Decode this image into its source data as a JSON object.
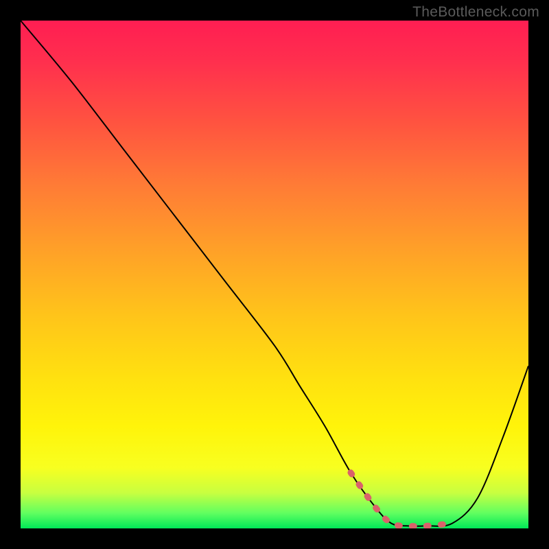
{
  "watermark": "TheBottleneck.com",
  "chart_data": {
    "type": "line",
    "title": "",
    "xlabel": "",
    "ylabel": "",
    "xlim": [
      0,
      100
    ],
    "ylim": [
      0,
      100
    ],
    "series": [
      {
        "name": "bottleneck-curve",
        "x": [
          0,
          10,
          20,
          30,
          40,
          50,
          55,
          60,
          65,
          70,
          73,
          76,
          80,
          85,
          90,
          95,
          100
        ],
        "values": [
          100,
          88,
          75,
          62,
          49,
          36,
          28,
          20,
          11,
          4,
          1,
          0.5,
          0.5,
          1,
          6,
          18,
          32
        ]
      }
    ],
    "optimal_zone": {
      "x_start": 65,
      "x_end": 87
    },
    "gradient_stops": [
      {
        "pos": 0,
        "color": "#ff1e52"
      },
      {
        "pos": 8,
        "color": "#ff2f4e"
      },
      {
        "pos": 20,
        "color": "#ff5340"
      },
      {
        "pos": 32,
        "color": "#ff7a36"
      },
      {
        "pos": 45,
        "color": "#ffa028"
      },
      {
        "pos": 58,
        "color": "#ffc41a"
      },
      {
        "pos": 70,
        "color": "#ffe010"
      },
      {
        "pos": 80,
        "color": "#fff40a"
      },
      {
        "pos": 88,
        "color": "#f8ff20"
      },
      {
        "pos": 93,
        "color": "#c8ff40"
      },
      {
        "pos": 97,
        "color": "#60ff60"
      },
      {
        "pos": 100,
        "color": "#00e858"
      }
    ],
    "accent_color": "#d9626a"
  }
}
